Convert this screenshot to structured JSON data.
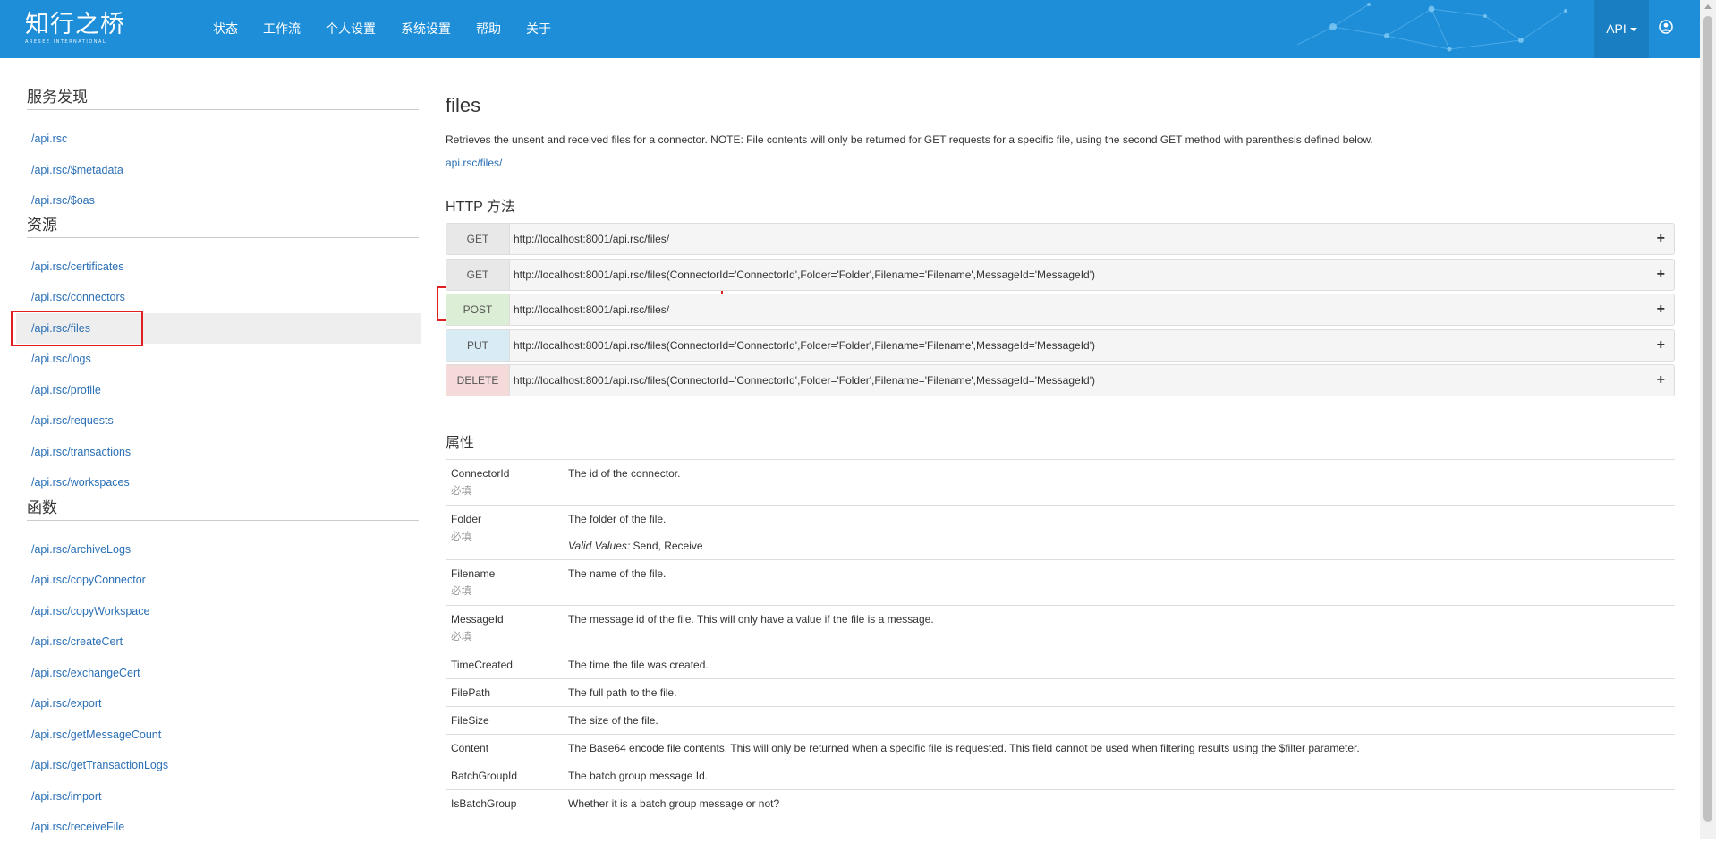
{
  "brand": {
    "title": "知行之桥",
    "subtitle": "ARESEE INTERNATIONAL"
  },
  "nav": [
    "状态",
    "工作流",
    "个人设置",
    "系统设置",
    "帮助",
    "关于"
  ],
  "api_menu": "API",
  "sidebar": {
    "sections": [
      {
        "title": "服务发现",
        "items": [
          "/api.rsc",
          "/api.rsc/$metadata",
          "/api.rsc/$oas"
        ]
      },
      {
        "title": "资源",
        "items": [
          "/api.rsc/certificates",
          "/api.rsc/connectors",
          "/api.rsc/files",
          "/api.rsc/logs",
          "/api.rsc/profile",
          "/api.rsc/requests",
          "/api.rsc/transactions",
          "/api.rsc/workspaces"
        ]
      },
      {
        "title": "函数",
        "items": [
          "/api.rsc/archiveLogs",
          "/api.rsc/copyConnector",
          "/api.rsc/copyWorkspace",
          "/api.rsc/createCert",
          "/api.rsc/exchangeCert",
          "/api.rsc/export",
          "/api.rsc/getMessageCount",
          "/api.rsc/getTransactionLogs",
          "/api.rsc/import",
          "/api.rsc/receiveFile"
        ]
      }
    ],
    "active": "/api.rsc/files"
  },
  "main": {
    "title": "files",
    "description": "Retrieves the unsent and received files for a connector. NOTE: File contents will only be returned for GET requests for a specific file, using the second GET method with parenthesis defined below.",
    "link": "api.rsc/files/",
    "methods_title": "HTTP 方法",
    "methods": [
      {
        "verb": "GET",
        "url": "http://localhost:8001/api.rsc/files/"
      },
      {
        "verb": "GET",
        "url": "http://localhost:8001/api.rsc/files(ConnectorId='ConnectorId',Folder='Folder',Filename='Filename',MessageId='MessageId')"
      },
      {
        "verb": "POST",
        "url": "http://localhost:8001/api.rsc/files/"
      },
      {
        "verb": "PUT",
        "url": "http://localhost:8001/api.rsc/files(ConnectorId='ConnectorId',Folder='Folder',Filename='Filename',MessageId='MessageId')"
      },
      {
        "verb": "DELETE",
        "url": "http://localhost:8001/api.rsc/files(ConnectorId='ConnectorId',Folder='Folder',Filename='Filename',MessageId='MessageId')"
      }
    ],
    "props_title": "属性",
    "required_label": "必填",
    "valid_values_label": "Valid Values:",
    "properties": [
      {
        "name": "ConnectorId",
        "required": true,
        "desc": "The id of the connector."
      },
      {
        "name": "Folder",
        "required": true,
        "desc": "The folder of the file.",
        "valid": "Send, Receive"
      },
      {
        "name": "Filename",
        "required": true,
        "desc": "The name of the file."
      },
      {
        "name": "MessageId",
        "required": true,
        "desc": "The message id of the file. This will only have a value if the file is a message."
      },
      {
        "name": "TimeCreated",
        "required": false,
        "desc": "The time the file was created."
      },
      {
        "name": "FilePath",
        "required": false,
        "desc": "The full path to the file."
      },
      {
        "name": "FileSize",
        "required": false,
        "desc": "The size of the file."
      },
      {
        "name": "Content",
        "required": false,
        "desc": "The Base64 encode file contents. This will only be returned when a specific file is requested. This field cannot be used when filtering results using the $filter parameter."
      },
      {
        "name": "BatchGroupId",
        "required": false,
        "desc": "The batch group message Id."
      },
      {
        "name": "IsBatchGroup",
        "required": false,
        "desc": "Whether it is a batch group message or not?"
      }
    ]
  }
}
